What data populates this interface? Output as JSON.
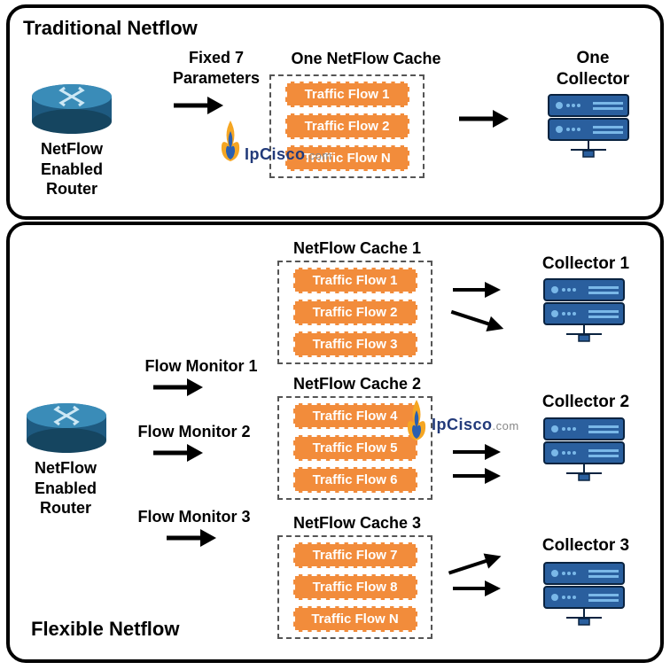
{
  "top": {
    "title": "Traditional Netflow",
    "params_label": "Fixed 7\nParameters",
    "cache_label": "One NetFlow Cache",
    "flows": [
      "Traffic Flow 1",
      "Traffic Flow 2",
      "Traffic Flow N"
    ],
    "router_label": "NetFlow\nEnabled\nRouter",
    "collector_label": "One\nCollector"
  },
  "bottom": {
    "title": "Flexible Netflow",
    "router_label": "NetFlow\nEnabled\nRouter",
    "monitors": [
      "Flow Monitor 1",
      "Flow Monitor 2",
      "Flow Monitor 3"
    ],
    "caches": [
      {
        "label": "NetFlow Cache 1",
        "flows": [
          "Traffic Flow 1",
          "Traffic Flow 2",
          "Traffic Flow 3"
        ]
      },
      {
        "label": "NetFlow Cache 2",
        "flows": [
          "Traffic Flow 4",
          "Traffic Flow 5",
          "Traffic Flow 6"
        ]
      },
      {
        "label": "NetFlow Cache 3",
        "flows": [
          "Traffic Flow 7",
          "Traffic Flow 8",
          "Traffic Flow N"
        ]
      }
    ],
    "collectors": [
      "Collector 1",
      "Collector 2",
      "Collector 3"
    ]
  },
  "watermark": "IpCisco"
}
